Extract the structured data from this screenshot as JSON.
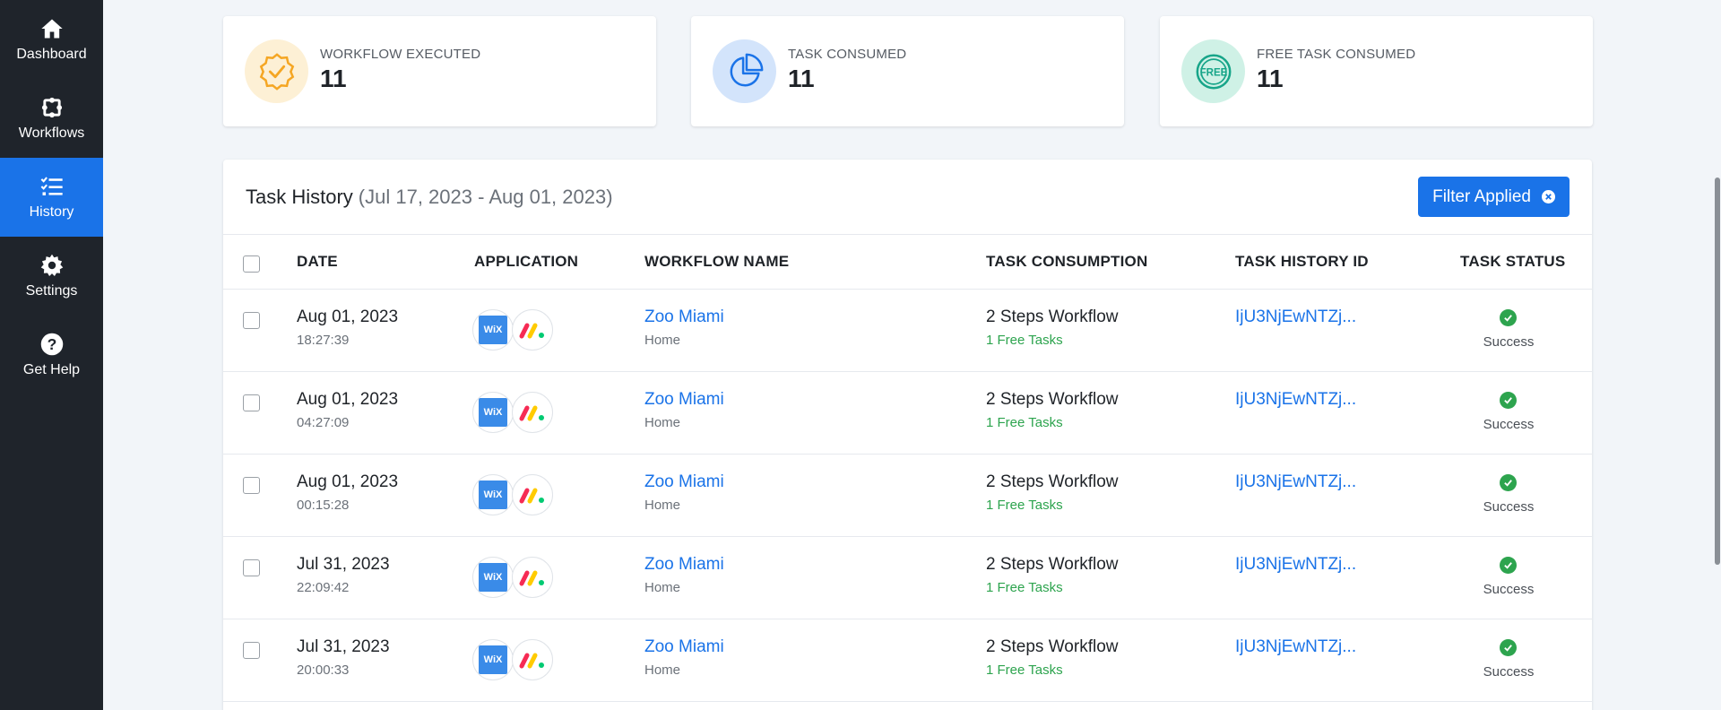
{
  "sidebar": {
    "items": [
      {
        "label": "Dashboard",
        "icon": "home-icon"
      },
      {
        "label": "Workflows",
        "icon": "workflows-icon"
      },
      {
        "label": "History",
        "icon": "history-list-icon",
        "active": true
      },
      {
        "label": "Settings",
        "icon": "gear-icon"
      },
      {
        "label": "Get Help",
        "icon": "help-icon"
      }
    ]
  },
  "stats": [
    {
      "label": "WORKFLOW EXECUTED",
      "value": "11",
      "icon": "badge-check-icon",
      "color": "#f5a623"
    },
    {
      "label": "TASK CONSUMED",
      "value": "11",
      "icon": "pie-chart-icon",
      "color": "#1a73e8"
    },
    {
      "label": "FREE TASK CONSUMED",
      "value": "11",
      "icon": "free-badge-icon",
      "color": "#17a589"
    }
  ],
  "history": {
    "title": "Task History",
    "range": "(Jul 17, 2023 - Aug 01, 2023)",
    "filter_label": "Filter Applied",
    "columns": [
      "DATE",
      "APPLICATION",
      "WORKFLOW NAME",
      "TASK CONSUMPTION",
      "TASK HISTORY ID",
      "TASK STATUS"
    ],
    "rows": [
      {
        "date": "Aug 01, 2023",
        "time": "18:27:39",
        "apps": [
          "wix",
          "monday"
        ],
        "workflow": "Zoo Miami",
        "workflow_sub": "Home",
        "consumption": "2 Steps Workflow",
        "free": "1 Free Tasks",
        "history_id": "IjU3NjEwNTZj...",
        "status": "Success"
      },
      {
        "date": "Aug 01, 2023",
        "time": "04:27:09",
        "apps": [
          "wix",
          "monday"
        ],
        "workflow": "Zoo Miami",
        "workflow_sub": "Home",
        "consumption": "2 Steps Workflow",
        "free": "1 Free Tasks",
        "history_id": "IjU3NjEwNTZj...",
        "status": "Success"
      },
      {
        "date": "Aug 01, 2023",
        "time": "00:15:28",
        "apps": [
          "wix",
          "monday"
        ],
        "workflow": "Zoo Miami",
        "workflow_sub": "Home",
        "consumption": "2 Steps Workflow",
        "free": "1 Free Tasks",
        "history_id": "IjU3NjEwNTZj...",
        "status": "Success"
      },
      {
        "date": "Jul 31, 2023",
        "time": "22:09:42",
        "apps": [
          "wix",
          "monday"
        ],
        "workflow": "Zoo Miami",
        "workflow_sub": "Home",
        "consumption": "2 Steps Workflow",
        "free": "1 Free Tasks",
        "history_id": "IjU3NjEwNTZj...",
        "status": "Success"
      },
      {
        "date": "Jul 31, 2023",
        "time": "20:00:33",
        "apps": [
          "wix",
          "monday"
        ],
        "workflow": "Zoo Miami",
        "workflow_sub": "Home",
        "consumption": "2 Steps Workflow",
        "free": "1 Free Tasks",
        "history_id": "IjU3NjEwNTZj...",
        "status": "Success"
      }
    ]
  },
  "colors": {
    "accent": "#1a73e8",
    "sidebar": "#1f242b",
    "success": "#2da44e"
  }
}
